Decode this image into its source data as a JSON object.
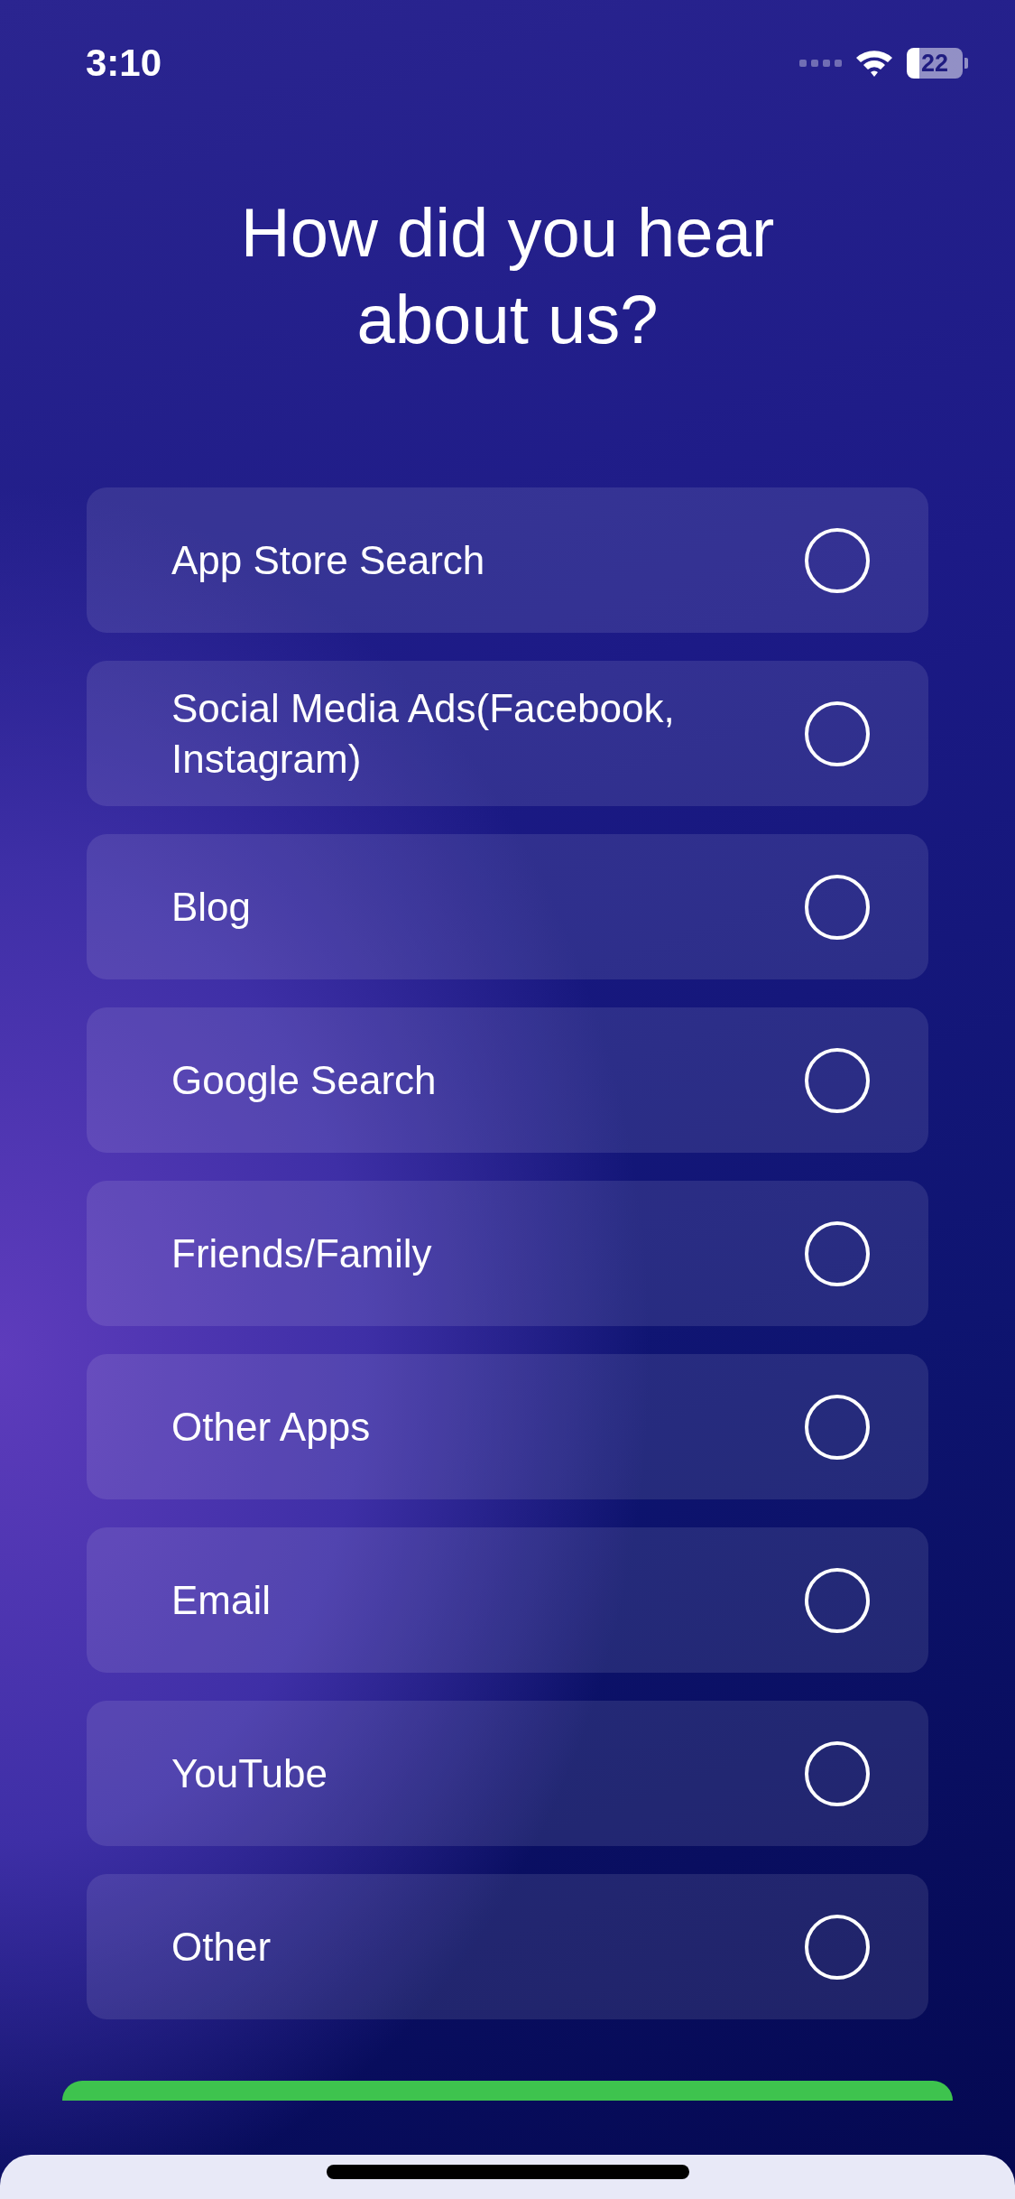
{
  "status_bar": {
    "time": "3:10",
    "battery": "22"
  },
  "title": "How did you hear about us?",
  "options": [
    {
      "label": "App Store Search",
      "selected": false
    },
    {
      "label": "Social Media Ads(Facebook, Instagram)",
      "selected": false
    },
    {
      "label": "Blog",
      "selected": false
    },
    {
      "label": "Google Search",
      "selected": false
    },
    {
      "label": "Friends/Family",
      "selected": false
    },
    {
      "label": "Other Apps",
      "selected": false
    },
    {
      "label": "Email",
      "selected": false
    },
    {
      "label": "YouTube",
      "selected": false
    },
    {
      "label": "Other",
      "selected": false
    }
  ]
}
